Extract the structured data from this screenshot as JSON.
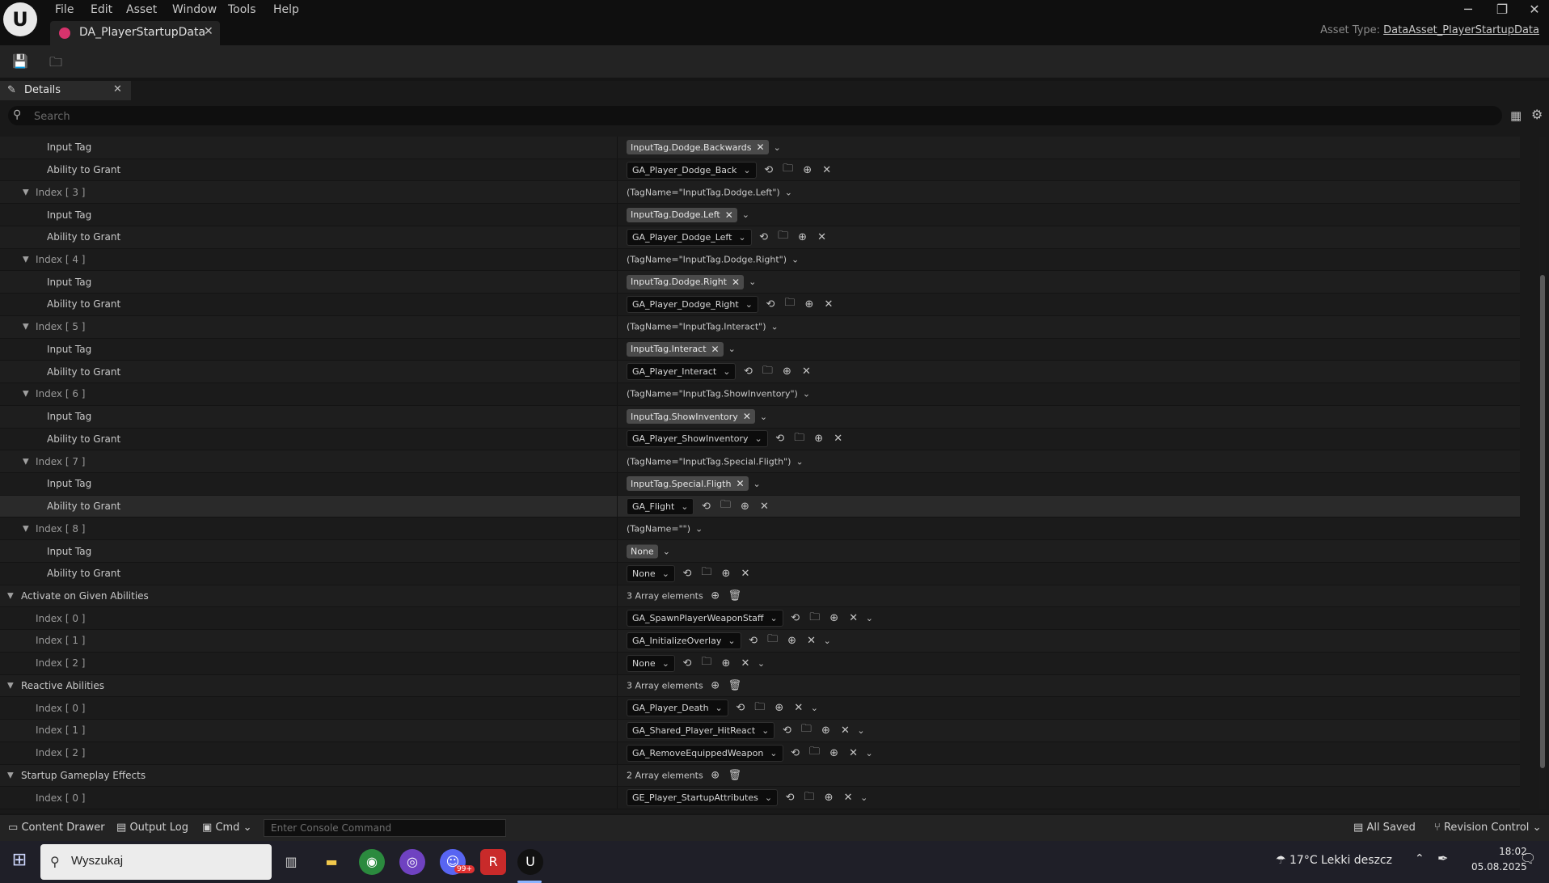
{
  "window": {
    "logo": "U",
    "menu": [
      "File",
      "Edit",
      "Asset",
      "Window",
      "Tools",
      "Help"
    ],
    "tab_title": "DA_PlayerStartupData",
    "asset_type_label": "Asset Type:",
    "asset_type_value": "DataAsset_PlayerStartupData"
  },
  "details": {
    "tab_label": "Details",
    "search_placeholder": "Search"
  },
  "rows": [
    {
      "kind": "tag",
      "label": "Input Tag",
      "tag": "InputTag.Dodge.Backwards"
    },
    {
      "kind": "ability",
      "label": "Ability to Grant",
      "value": "GA_Player_Dodge_Back"
    },
    {
      "kind": "index",
      "label": "Index [ 3 ]",
      "summary": "(TagName=\"InputTag.Dodge.Left\")"
    },
    {
      "kind": "tag",
      "label": "Input Tag",
      "tag": "InputTag.Dodge.Left"
    },
    {
      "kind": "ability",
      "label": "Ability to Grant",
      "value": "GA_Player_Dodge_Left"
    },
    {
      "kind": "index",
      "label": "Index [ 4 ]",
      "summary": "(TagName=\"InputTag.Dodge.Right\")"
    },
    {
      "kind": "tag",
      "label": "Input Tag",
      "tag": "InputTag.Dodge.Right"
    },
    {
      "kind": "ability",
      "label": "Ability to Grant",
      "value": "GA_Player_Dodge_Right"
    },
    {
      "kind": "index",
      "label": "Index [ 5 ]",
      "summary": "(TagName=\"InputTag.Interact\")"
    },
    {
      "kind": "tag",
      "label": "Input Tag",
      "tag": "InputTag.Interact"
    },
    {
      "kind": "ability",
      "label": "Ability to Grant",
      "value": "GA_Player_Interact"
    },
    {
      "kind": "index",
      "label": "Index [ 6 ]",
      "summary": "(TagName=\"InputTag.ShowInventory\")"
    },
    {
      "kind": "tag",
      "label": "Input Tag",
      "tag": "InputTag.ShowInventory"
    },
    {
      "kind": "ability",
      "label": "Ability to Grant",
      "value": "GA_Player_ShowInventory"
    },
    {
      "kind": "index",
      "label": "Index [ 7 ]",
      "summary": "(TagName=\"InputTag.Special.Fligth\")"
    },
    {
      "kind": "tag",
      "label": "Input Tag",
      "tag": "InputTag.Special.Fligth"
    },
    {
      "kind": "ability",
      "label": "Ability to Grant",
      "value": "GA_Flight",
      "highlight": true
    },
    {
      "kind": "index",
      "label": "Index [ 8 ]",
      "summary": "(TagName=\"\")"
    },
    {
      "kind": "tag",
      "label": "Input Tag",
      "tag": "None",
      "empty": true
    },
    {
      "kind": "ability",
      "label": "Ability to Grant",
      "value": "None"
    },
    {
      "kind": "category",
      "label": "Activate on Given Abilities",
      "summary": "3 Array elements"
    },
    {
      "kind": "arr",
      "label": "Index [ 0 ]",
      "value": "GA_SpawnPlayerWeaponStaff"
    },
    {
      "kind": "arr",
      "label": "Index [ 1 ]",
      "value": "GA_InitializeOverlay"
    },
    {
      "kind": "arr",
      "label": "Index [ 2 ]",
      "value": "None"
    },
    {
      "kind": "category",
      "label": "Reactive Abilities",
      "summary": "3 Array elements"
    },
    {
      "kind": "arr",
      "label": "Index [ 0 ]",
      "value": "GA_Player_Death"
    },
    {
      "kind": "arr",
      "label": "Index [ 1 ]",
      "value": "GA_Shared_Player_HitReact"
    },
    {
      "kind": "arr",
      "label": "Index [ 2 ]",
      "value": "GA_RemoveEquippedWeapon"
    },
    {
      "kind": "category",
      "label": "Startup Gameplay Effects",
      "summary": "2 Array elements"
    },
    {
      "kind": "arr",
      "label": "Index [ 0 ]",
      "value": "GE_Player_StartupAttributes"
    }
  ],
  "bottom_bar": {
    "content_drawer": "Content Drawer",
    "output_log": "Output Log",
    "cmd": "Cmd",
    "console_placeholder": "Enter Console Command",
    "all_saved": "All Saved",
    "revision_control": "Revision Control"
  },
  "taskbar": {
    "search_label": "Wyszukaj",
    "weather": "17°C  Lekki deszcz",
    "time": "18:02",
    "date": "05.08.2025",
    "discord_badge": "99+"
  }
}
